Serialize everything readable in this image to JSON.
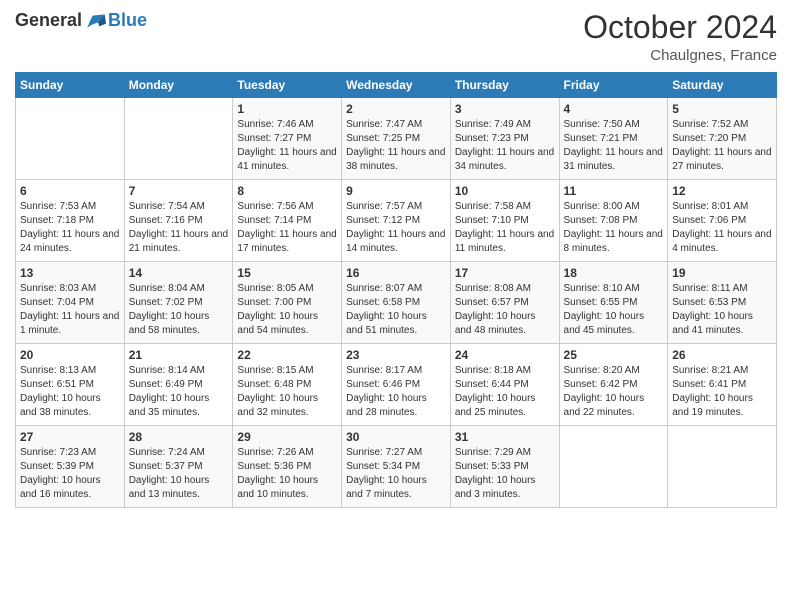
{
  "logo": {
    "general": "General",
    "blue": "Blue"
  },
  "header": {
    "month": "October 2024",
    "location": "Chaulgnes, France"
  },
  "days_of_week": [
    "Sunday",
    "Monday",
    "Tuesday",
    "Wednesday",
    "Thursday",
    "Friday",
    "Saturday"
  ],
  "weeks": [
    [
      {
        "day": "",
        "info": ""
      },
      {
        "day": "",
        "info": ""
      },
      {
        "day": "1",
        "info": "Sunrise: 7:46 AM\nSunset: 7:27 PM\nDaylight: 11 hours and 41 minutes."
      },
      {
        "day": "2",
        "info": "Sunrise: 7:47 AM\nSunset: 7:25 PM\nDaylight: 11 hours and 38 minutes."
      },
      {
        "day": "3",
        "info": "Sunrise: 7:49 AM\nSunset: 7:23 PM\nDaylight: 11 hours and 34 minutes."
      },
      {
        "day": "4",
        "info": "Sunrise: 7:50 AM\nSunset: 7:21 PM\nDaylight: 11 hours and 31 minutes."
      },
      {
        "day": "5",
        "info": "Sunrise: 7:52 AM\nSunset: 7:20 PM\nDaylight: 11 hours and 27 minutes."
      }
    ],
    [
      {
        "day": "6",
        "info": "Sunrise: 7:53 AM\nSunset: 7:18 PM\nDaylight: 11 hours and 24 minutes."
      },
      {
        "day": "7",
        "info": "Sunrise: 7:54 AM\nSunset: 7:16 PM\nDaylight: 11 hours and 21 minutes."
      },
      {
        "day": "8",
        "info": "Sunrise: 7:56 AM\nSunset: 7:14 PM\nDaylight: 11 hours and 17 minutes."
      },
      {
        "day": "9",
        "info": "Sunrise: 7:57 AM\nSunset: 7:12 PM\nDaylight: 11 hours and 14 minutes."
      },
      {
        "day": "10",
        "info": "Sunrise: 7:58 AM\nSunset: 7:10 PM\nDaylight: 11 hours and 11 minutes."
      },
      {
        "day": "11",
        "info": "Sunrise: 8:00 AM\nSunset: 7:08 PM\nDaylight: 11 hours and 8 minutes."
      },
      {
        "day": "12",
        "info": "Sunrise: 8:01 AM\nSunset: 7:06 PM\nDaylight: 11 hours and 4 minutes."
      }
    ],
    [
      {
        "day": "13",
        "info": "Sunrise: 8:03 AM\nSunset: 7:04 PM\nDaylight: 11 hours and 1 minute."
      },
      {
        "day": "14",
        "info": "Sunrise: 8:04 AM\nSunset: 7:02 PM\nDaylight: 10 hours and 58 minutes."
      },
      {
        "day": "15",
        "info": "Sunrise: 8:05 AM\nSunset: 7:00 PM\nDaylight: 10 hours and 54 minutes."
      },
      {
        "day": "16",
        "info": "Sunrise: 8:07 AM\nSunset: 6:58 PM\nDaylight: 10 hours and 51 minutes."
      },
      {
        "day": "17",
        "info": "Sunrise: 8:08 AM\nSunset: 6:57 PM\nDaylight: 10 hours and 48 minutes."
      },
      {
        "day": "18",
        "info": "Sunrise: 8:10 AM\nSunset: 6:55 PM\nDaylight: 10 hours and 45 minutes."
      },
      {
        "day": "19",
        "info": "Sunrise: 8:11 AM\nSunset: 6:53 PM\nDaylight: 10 hours and 41 minutes."
      }
    ],
    [
      {
        "day": "20",
        "info": "Sunrise: 8:13 AM\nSunset: 6:51 PM\nDaylight: 10 hours and 38 minutes."
      },
      {
        "day": "21",
        "info": "Sunrise: 8:14 AM\nSunset: 6:49 PM\nDaylight: 10 hours and 35 minutes."
      },
      {
        "day": "22",
        "info": "Sunrise: 8:15 AM\nSunset: 6:48 PM\nDaylight: 10 hours and 32 minutes."
      },
      {
        "day": "23",
        "info": "Sunrise: 8:17 AM\nSunset: 6:46 PM\nDaylight: 10 hours and 28 minutes."
      },
      {
        "day": "24",
        "info": "Sunrise: 8:18 AM\nSunset: 6:44 PM\nDaylight: 10 hours and 25 minutes."
      },
      {
        "day": "25",
        "info": "Sunrise: 8:20 AM\nSunset: 6:42 PM\nDaylight: 10 hours and 22 minutes."
      },
      {
        "day": "26",
        "info": "Sunrise: 8:21 AM\nSunset: 6:41 PM\nDaylight: 10 hours and 19 minutes."
      }
    ],
    [
      {
        "day": "27",
        "info": "Sunrise: 7:23 AM\nSunset: 5:39 PM\nDaylight: 10 hours and 16 minutes."
      },
      {
        "day": "28",
        "info": "Sunrise: 7:24 AM\nSunset: 5:37 PM\nDaylight: 10 hours and 13 minutes."
      },
      {
        "day": "29",
        "info": "Sunrise: 7:26 AM\nSunset: 5:36 PM\nDaylight: 10 hours and 10 minutes."
      },
      {
        "day": "30",
        "info": "Sunrise: 7:27 AM\nSunset: 5:34 PM\nDaylight: 10 hours and 7 minutes."
      },
      {
        "day": "31",
        "info": "Sunrise: 7:29 AM\nSunset: 5:33 PM\nDaylight: 10 hours and 3 minutes."
      },
      {
        "day": "",
        "info": ""
      },
      {
        "day": "",
        "info": ""
      }
    ]
  ]
}
